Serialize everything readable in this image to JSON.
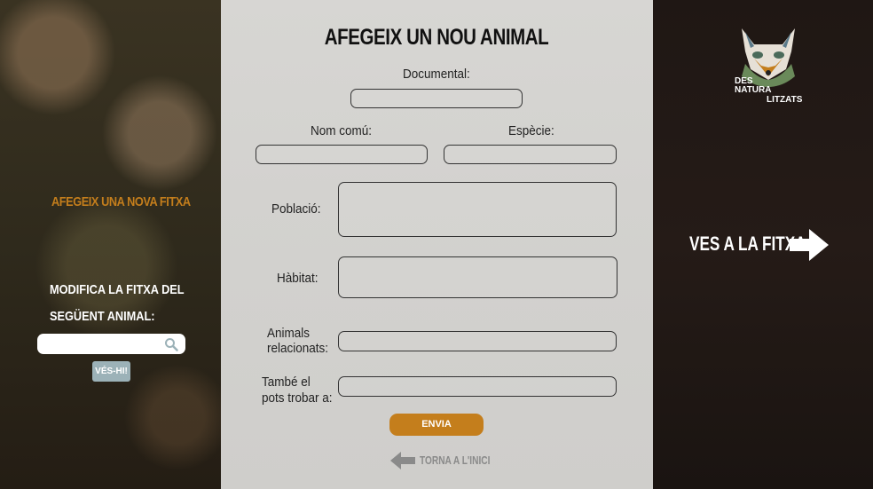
{
  "left": {
    "new_sheet": "AFEGEIX UNA NOVA FITXA",
    "modify_text": "MODIFICA LA FITXA DEL SEGÜENT ANIMAL:",
    "search": {
      "value": "",
      "placeholder": ""
    },
    "go_label": "VÉS-HI!"
  },
  "form": {
    "title": "AFEGEIX UN NOU ANIMAL",
    "documental_label": "Documental:",
    "common_name_label": "Nom comú:",
    "species_label": "Espècie:",
    "population_label": "Població:",
    "habitat_label": "Hàbitat:",
    "related_label_1": "Animals",
    "related_label_2": "relacionats:",
    "also_label_1": "També el",
    "also_label_2": "pots trobar a:",
    "send_label": "ENVIA",
    "back_label": "TORNA A L'INICI"
  },
  "right": {
    "logo": {
      "line1": "DES",
      "line2": "NATURA",
      "line3": "LITZATS"
    },
    "goto_label": "VES A LA FITXA"
  },
  "colors": {
    "accent": "#c47e1c",
    "button_grey": "#9cb2b8"
  },
  "icons": [
    "search-icon",
    "arrow-left-icon",
    "arrow-right-icon",
    "fox-logo"
  ]
}
